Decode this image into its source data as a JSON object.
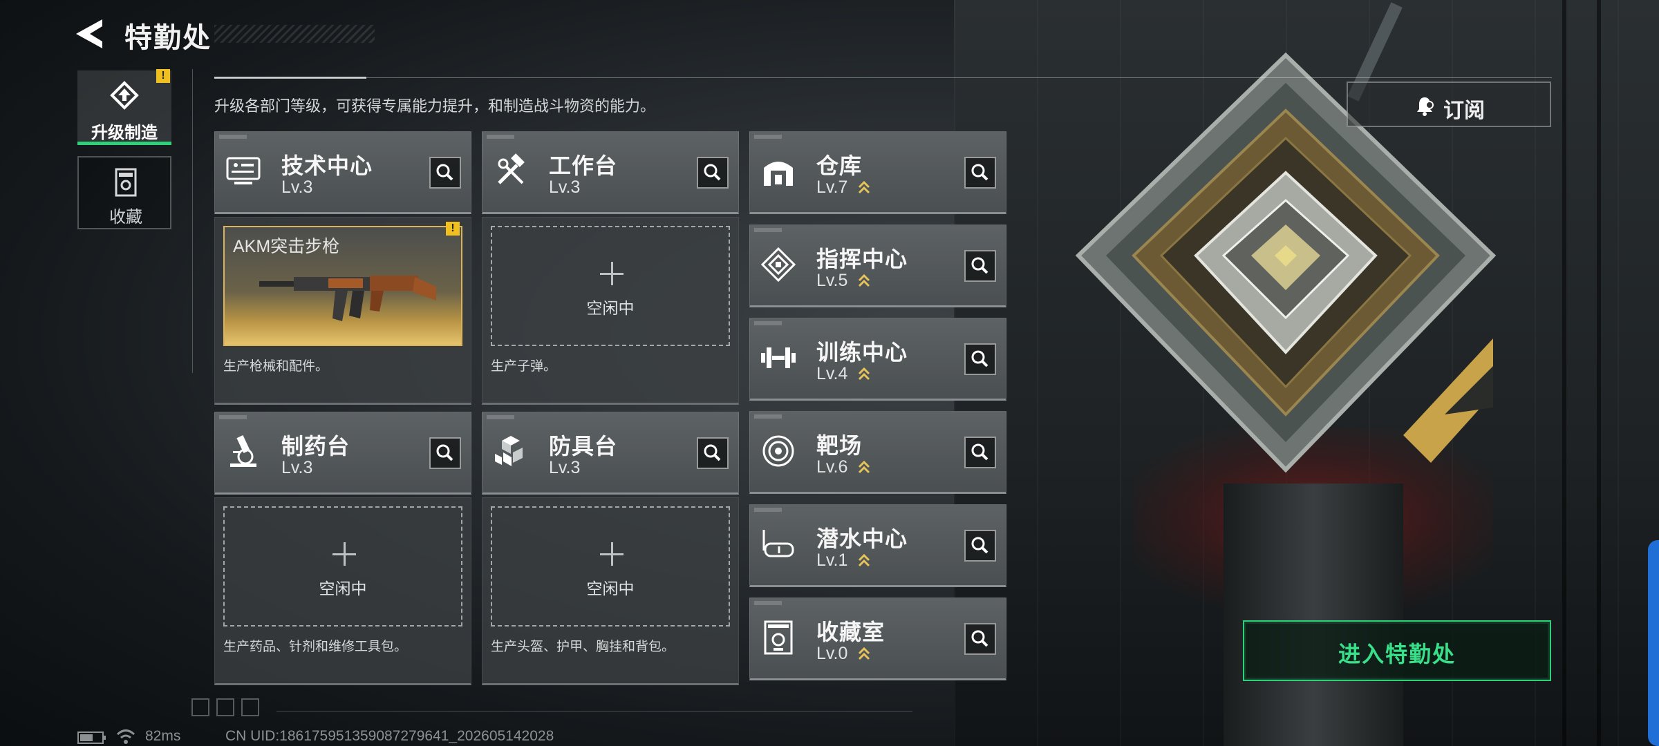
{
  "header": {
    "title": "特勤处",
    "description": "升级各部门等级，可获得专属能力提升，和制造战斗物资的能力。"
  },
  "nav": {
    "tabs": [
      {
        "label": "升级制造",
        "icon": "upgrade-icon",
        "active": true,
        "alert": "!"
      },
      {
        "label": "收藏",
        "icon": "collection-icon",
        "active": false
      }
    ]
  },
  "facilities_large": [
    {
      "name": "技术中心",
      "level": "Lv.3",
      "icon": "computer-icon",
      "slot": {
        "type": "item",
        "item_name": "AKM突击步枪",
        "alert": "!"
      },
      "note": "生产枪械和配件。"
    },
    {
      "name": "工作台",
      "level": "Lv.3",
      "icon": "tools-icon",
      "slot": {
        "type": "empty",
        "idle_label": "空闲中"
      },
      "note": "生产子弹。"
    },
    {
      "name": "制药台",
      "level": "Lv.3",
      "icon": "microscope-icon",
      "slot": {
        "type": "empty",
        "idle_label": "空闲中"
      },
      "note": "生产药品、针剂和维修工具包。"
    },
    {
      "name": "防具台",
      "level": "Lv.3",
      "icon": "armor-blocks-icon",
      "slot": {
        "type": "empty",
        "idle_label": "空闲中"
      },
      "note": "生产头盔、护甲、胸挂和背包。"
    }
  ],
  "facilities_small": [
    {
      "name": "仓库",
      "level": "Lv.7",
      "icon": "warehouse-icon",
      "upgradable": true
    },
    {
      "name": "指挥中心",
      "level": "Lv.5",
      "icon": "chip-icon",
      "upgradable": true
    },
    {
      "name": "训练中心",
      "level": "Lv.4",
      "icon": "dumbbell-icon",
      "upgradable": true
    },
    {
      "name": "靶场",
      "level": "Lv.6",
      "icon": "target-icon",
      "upgradable": true
    },
    {
      "name": "潜水中心",
      "level": "Lv.1",
      "icon": "diving-mask-icon",
      "upgradable": true
    },
    {
      "name": "收藏室",
      "level": "Lv.0",
      "icon": "trophy-case-icon",
      "upgradable": true
    }
  ],
  "actions": {
    "subscribe": "订阅",
    "enter": "进入特勤处"
  },
  "status_bar": {
    "ping": "82ms",
    "uid": "CN UID:18617595135908727964​1_202605142028"
  },
  "colors": {
    "accent_green": "#2fd07a",
    "upgrade_chevron": "#e6c45a",
    "alert_yellow": "#f0c020",
    "edge_tab_blue": "#1f6fd6"
  }
}
